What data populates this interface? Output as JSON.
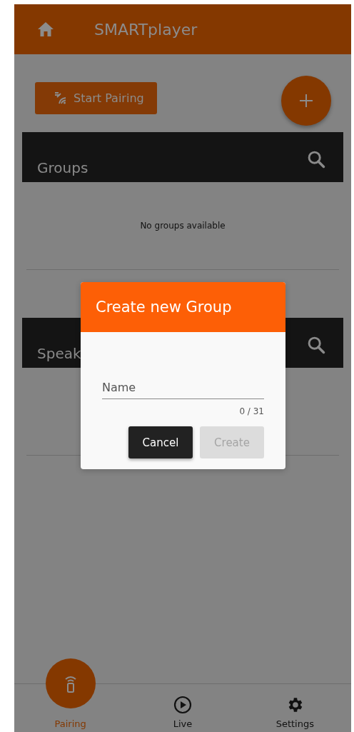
{
  "app_bar": {
    "title": "SMARTplayer"
  },
  "start_pairing": {
    "label": "Start Pairing"
  },
  "sections": [
    {
      "title": "Groups",
      "empty_text": "No groups available"
    },
    {
      "title": "Speak"
    }
  ],
  "dialog": {
    "title": "Create new Group",
    "name_field": {
      "placeholder": "Name",
      "counter": "0 / 31"
    },
    "buttons": [
      {
        "label": "Cancel",
        "disabled": false
      },
      {
        "label": "Create",
        "disabled": true
      }
    ]
  },
  "bottom_nav": [
    {
      "label": "Pairing",
      "selected": true,
      "kind": "remote"
    },
    {
      "label": "Live",
      "selected": false,
      "kind": "play"
    },
    {
      "label": "Settings",
      "selected": false,
      "kind": "gear"
    }
  ]
}
